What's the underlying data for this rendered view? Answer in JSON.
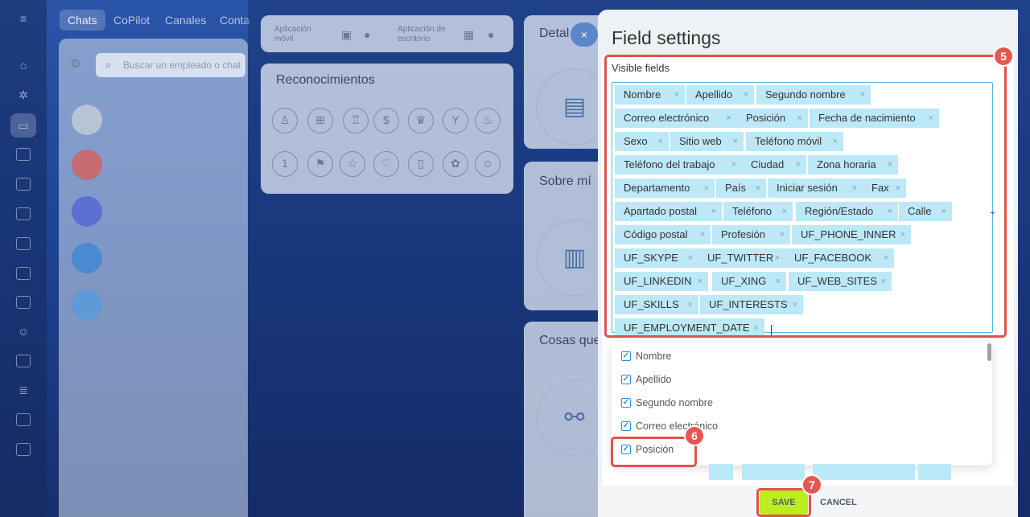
{
  "background": {
    "nav_tabs": [
      "Chats",
      "CoPilot",
      "Canales",
      "Conta"
    ],
    "chat_search_placeholder": "Buscar un empleado o chat",
    "apps": {
      "mobile_label": "Aplicación móvil",
      "desktop_label": "Aplicación de escritorio"
    },
    "cards": {
      "recognitions_title": "Reconocimientos",
      "details_title": "Detal",
      "about_title": "Sobre mí",
      "things_title": "Cosas que"
    }
  },
  "slider": {
    "close_label": "×",
    "title": "Field settings",
    "visible_fields_label": "Visible fields",
    "visible_fields": [
      "Nombre",
      "Apellido",
      "Segundo nombre",
      "Correo electrónico",
      "Posición",
      "Fecha de nacimiento",
      "Sexo",
      "Sitio web",
      "Teléfono móvil",
      "Teléfono del trabajo",
      "Ciudad",
      "Zona horaria",
      "Departamento",
      "País",
      "Iniciar sesión",
      "Fax",
      "Apartado postal",
      "Teléfono",
      "Región/Estado",
      "Calle",
      "Código postal",
      "Profesión",
      "UF_PHONE_INNER",
      "UF_SKYPE",
      "UF_TWITTER",
      "UF_FACEBOOK",
      "UF_LINKEDIN",
      "UF_XING",
      "UF_WEB_SITES",
      "UF_SKILLS",
      "UF_INTERESTS",
      "UF_EMPLOYMENT_DATE"
    ],
    "remove_glyph": "×",
    "dropdown_options": [
      {
        "label": "Nombre",
        "checked": true
      },
      {
        "label": "Apellido",
        "checked": true
      },
      {
        "label": "Segundo nombre",
        "checked": true
      },
      {
        "label": "Correo electrónico",
        "checked": true
      },
      {
        "label": "Posición",
        "checked": true
      }
    ],
    "save_label": "SAVE",
    "cancel_label": "CANCEL"
  },
  "step_badges": [
    "5",
    "6",
    "7"
  ],
  "colors": {
    "tag_bg": "#bce8f7",
    "highlight": "#e0524d",
    "save_bg": "#bbed21",
    "checkbox": "#2d8fd8"
  }
}
